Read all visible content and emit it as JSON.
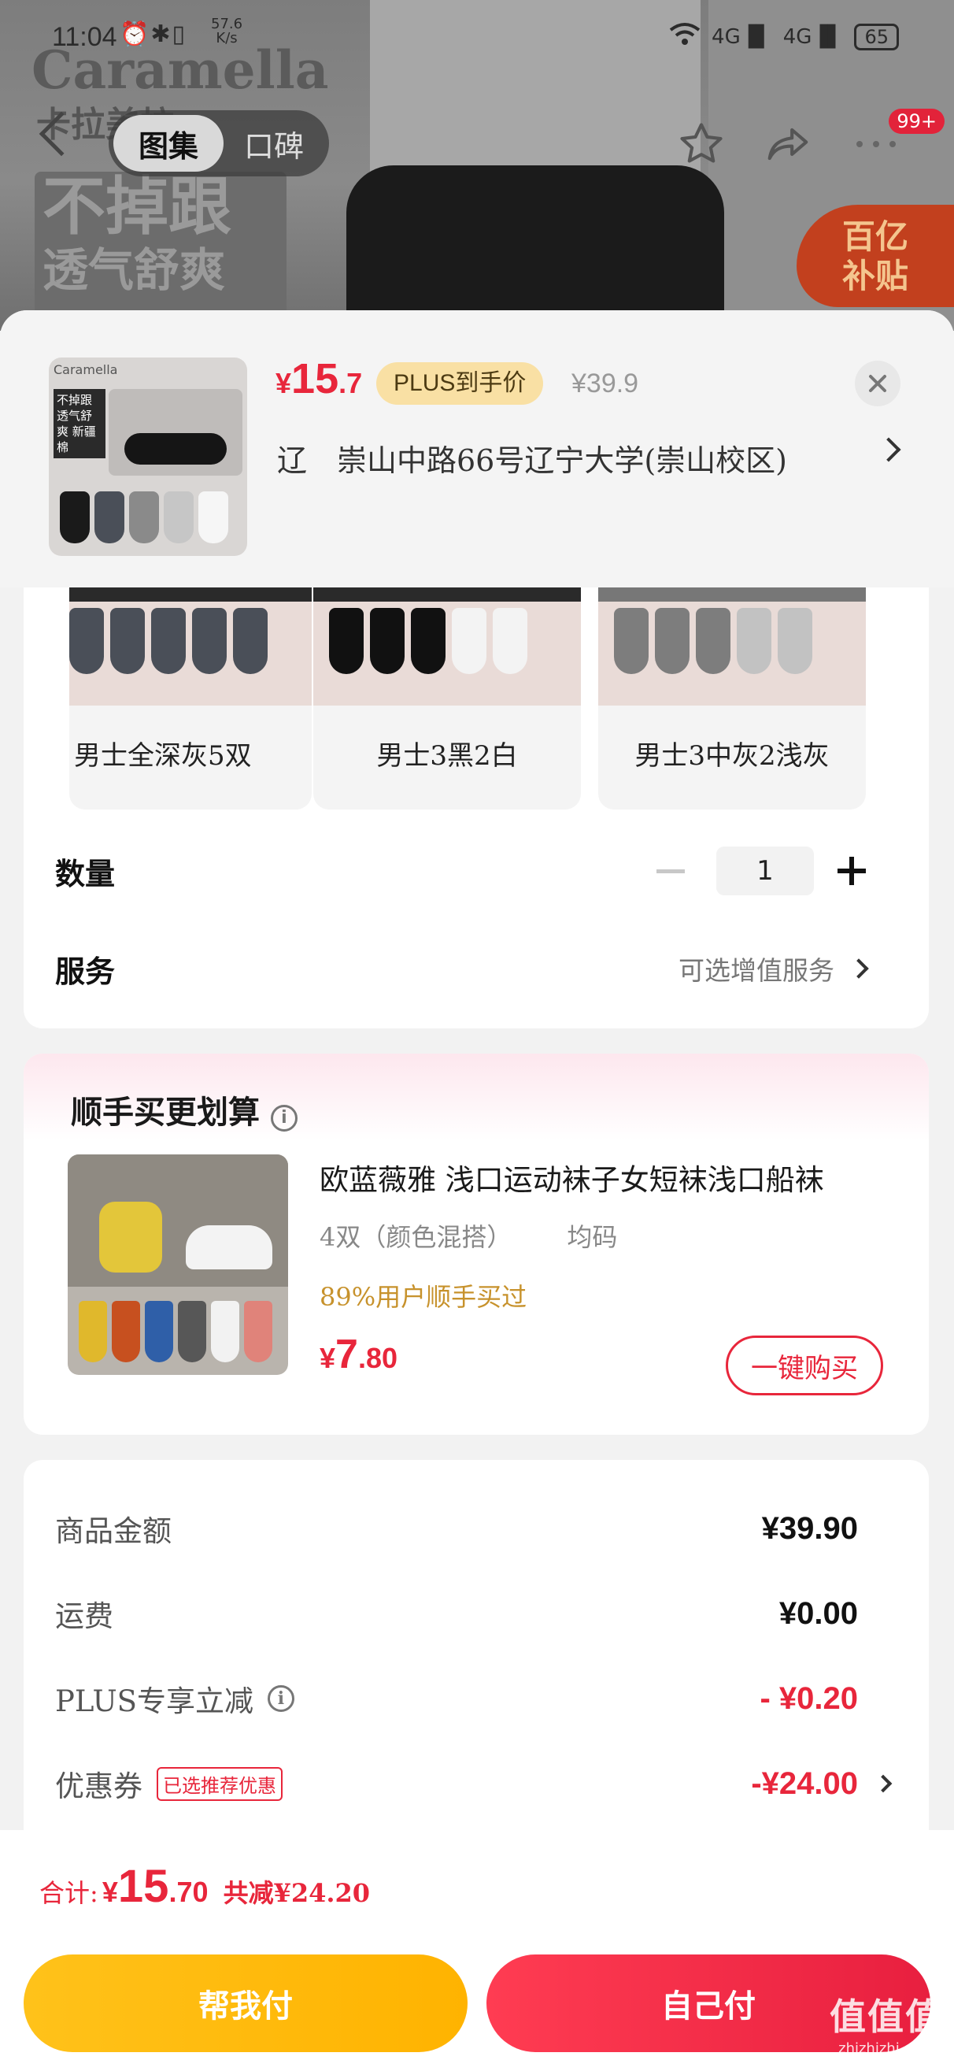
{
  "status_bar": {
    "time": "11:04",
    "speed_value": "57.6",
    "speed_unit": "K/s",
    "network": "4G",
    "network2": "4G",
    "battery": "65"
  },
  "background": {
    "brand_logo": "Caramella",
    "brand_cn": "卡拉美拉",
    "promo_line1": "不掉跟",
    "promo_line2": "透气舒爽",
    "subsidy_line1": "百亿",
    "subsidy_line2": "补贴"
  },
  "nav": {
    "tabs": [
      {
        "label": "图集"
      },
      {
        "label": "口碑"
      }
    ],
    "badge": "99+"
  },
  "product": {
    "thumb_brand": "Caramella",
    "thumb_tag": "不掉跟 透气舒爽 新疆棉",
    "price_currency": "¥",
    "price_int": "15",
    "price_dec": ".7",
    "plus_label": "PLUS到手价",
    "original_price": "¥39.9",
    "address": "辽　崇山中路66号辽宁大学(崇山校区)"
  },
  "variants": [
    {
      "label": "男士全深灰5双"
    },
    {
      "label": "男士3黑2白"
    },
    {
      "label": "男士3中灰2浅灰"
    }
  ],
  "quantity": {
    "label": "数量",
    "value": "1"
  },
  "service": {
    "label": "服务",
    "value": "可选增值服务"
  },
  "bundle": {
    "title": "顺手买更划算",
    "name": "欧蓝薇雅 浅口运动袜子女短袜浅口船袜",
    "spec": "4双（颜色混搭）",
    "size": "均码",
    "buyers": "89%用户顺手买过",
    "price_currency": "¥",
    "price_int": "7",
    "price_dec": ".80",
    "button": "一键购买"
  },
  "summary": {
    "rows": [
      {
        "label": "商品金额",
        "value": "¥39.90"
      },
      {
        "label": "运费",
        "value": "¥0.00"
      },
      {
        "label": "PLUS专享立减",
        "value": "- ¥0.20"
      },
      {
        "label": "优惠券",
        "tag": "已选推荐优惠",
        "value": "-¥24.00"
      }
    ]
  },
  "footer": {
    "total_label": "合计:",
    "total_currency": "¥",
    "total_int": "15",
    "total_dec": ".70",
    "saving": "共减¥24.20",
    "help_pay": "帮我付",
    "self_pay": "自己付",
    "watermark_big": "值值值",
    "watermark_url": "zhizhizhi.com"
  },
  "colors": {
    "accent_red": "#e8263b",
    "plus_gold": "#f9e0a4",
    "help_yellow": "#ffc21a"
  }
}
